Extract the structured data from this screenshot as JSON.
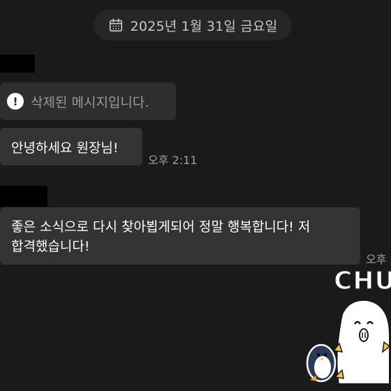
{
  "date_divider": {
    "icon": "calendar-icon",
    "text": "2025년 1월 31일 금요일"
  },
  "messages": [
    {
      "type": "deleted",
      "icon": "exclamation-icon",
      "text": "삭제된 메시지입니다."
    },
    {
      "type": "text",
      "text": "안녕하세요 원장님!",
      "time": "오후 2:11"
    },
    {
      "type": "text",
      "lines": [
        "좋은 소식으로 다시 찾아뵙게되어 정말 행복합니다! 저",
        "합격했습니다!"
      ],
      "time": "오후"
    }
  ],
  "sticker": {
    "text": "CHU",
    "icon": "chu-penguin-sticker"
  },
  "colors": {
    "background": "#1a1a1a",
    "bubble": "#333333",
    "pill": "#262626",
    "muted_text": "#9a9a9a"
  }
}
